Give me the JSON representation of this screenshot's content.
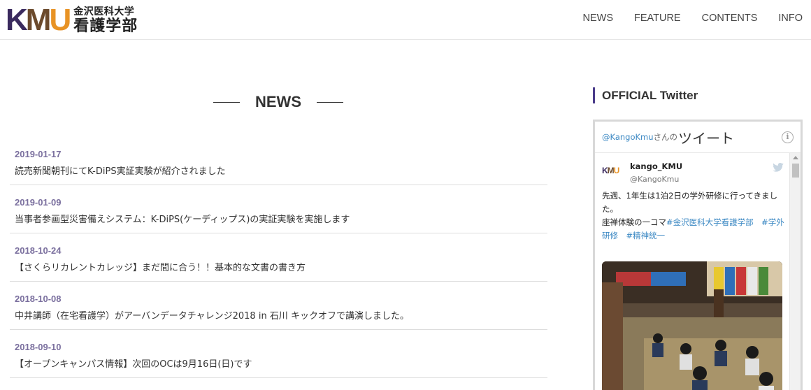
{
  "header": {
    "logo_mark_k": "K",
    "logo_mark_m": "M",
    "logo_mark_u": "U",
    "logo_sub": "金沢医科大学",
    "logo_main": "看護学部",
    "nav": [
      "NEWS",
      "FEATURE",
      "CONTENTS",
      "INFO"
    ]
  },
  "news": {
    "heading": "NEWS",
    "items": [
      {
        "date": "2019-01-17",
        "text": "読売新聞朝刊にてK-DiPS実証実験が紹介されました"
      },
      {
        "date": "2019-01-09",
        "text": "当事者参画型災害備えシステム：K-DiPS(ケーディップス)の実証実験を実施します"
      },
      {
        "date": "2018-10-24",
        "text": "【さくらリカレントカレッジ】まだ間に合う！！基本的な文書の書き方"
      },
      {
        "date": "2018-10-08",
        "text": "中井講師（在宅看護学）がアーバンデータチャレンジ2018 in 石川 キックオフで講演しました。"
      },
      {
        "date": "2018-09-10",
        "text": "【オープンキャンパス情報】次回のOCは9月16日(日)です"
      }
    ]
  },
  "twitter": {
    "heading": "OFFICIAL Twitter",
    "widget_handle": "@KangoKmu",
    "widget_suffix": "さんの",
    "widget_tweets": "ツイート",
    "tweet": {
      "name": "kango_KMU",
      "user": "@KangoKmu",
      "line1": "先週、1年生は1泊2日の学外研修に行ってきました。",
      "line2_prefix": "座禅体験の一コマ",
      "tags": [
        "#金沢医科大学看護学部",
        "#学外研修",
        "#精神統一"
      ]
    }
  },
  "colors": {
    "brand_purple": "#4a3b8a",
    "date_purple": "#7a6f9e",
    "logo_orange": "#e89325",
    "link_blue": "#3b88c3"
  }
}
